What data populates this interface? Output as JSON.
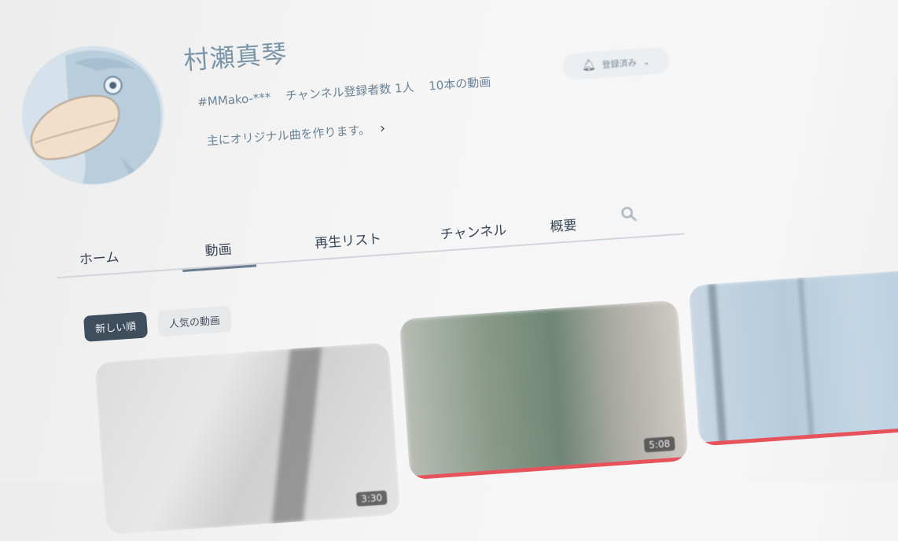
{
  "channel": {
    "name": "村瀬真琴",
    "handle": "#MMako-***",
    "subscribers": "チャンネル登録者数 1人",
    "video_count": "10本の動画",
    "description": "主にオリジナル曲を作ります。",
    "subscribe_label": "登録済み"
  },
  "icons": {
    "bell": "bell-icon",
    "chevron_down": "chevron-down-icon",
    "chevron_right": "chevron-right-icon",
    "search": "search-icon"
  },
  "tabs": [
    {
      "label": "ホーム",
      "active": false
    },
    {
      "label": "動画",
      "active": true
    },
    {
      "label": "再生リスト",
      "active": false
    },
    {
      "label": "チャンネル",
      "active": false
    },
    {
      "label": "概要",
      "active": false
    }
  ],
  "filters": [
    {
      "label": "新しい順",
      "active": true
    },
    {
      "label": "人気の動画",
      "active": false
    }
  ],
  "videos": [
    {
      "duration": "3:30",
      "progress": 0.0
    },
    {
      "duration": "5:08",
      "progress": 1.0
    },
    {
      "duration": "",
      "progress": 1.0
    }
  ],
  "colors": {
    "accent": "#6c7d8e",
    "progress_red": "#e7535a",
    "chip_active_bg": "#3f4e5c",
    "title_blue": "#7b95a8"
  }
}
